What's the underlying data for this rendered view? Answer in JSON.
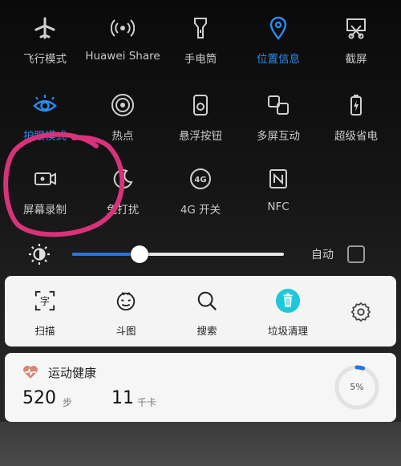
{
  "quick_settings": {
    "row1": [
      {
        "label": "飞行模式",
        "icon": "airplane-icon",
        "active": false
      },
      {
        "label": "Huawei Share",
        "icon": "huawei-share-icon",
        "active": false
      },
      {
        "label": "手电筒",
        "icon": "flashlight-icon",
        "active": false
      },
      {
        "label": "位置信息",
        "icon": "location-icon",
        "active": true
      },
      {
        "label": "截屏",
        "icon": "screenshot-icon",
        "active": false
      }
    ],
    "row2": [
      {
        "label": "护眼模式",
        "icon": "eye-icon",
        "active": true
      },
      {
        "label": "热点",
        "icon": "hotspot-icon",
        "active": false
      },
      {
        "label": "悬浮按钮",
        "icon": "floating-button-icon",
        "active": false
      },
      {
        "label": "多屏互动",
        "icon": "multiscreen-icon",
        "active": false
      },
      {
        "label": "超级省电",
        "icon": "battery-saver-icon",
        "active": false
      }
    ],
    "row3": [
      {
        "label": "屏幕录制",
        "icon": "screen-record-icon",
        "active": false
      },
      {
        "label": "免打扰",
        "icon": "moon-icon",
        "active": false
      },
      {
        "label": "4G 开关",
        "icon": "4g-icon",
        "active": false
      },
      {
        "label": "NFC",
        "icon": "nfc-icon",
        "active": false
      }
    ]
  },
  "brightness": {
    "level": 0.32,
    "auto_label": "自动",
    "auto_checked": false
  },
  "quick_actions": [
    {
      "label": "扫描",
      "icon": "scan-icon"
    },
    {
      "label": "斗图",
      "icon": "emoji-face-icon"
    },
    {
      "label": "搜索",
      "icon": "search-icon"
    },
    {
      "label": "垃圾清理",
      "icon": "trash-icon"
    }
  ],
  "health": {
    "title": "运动健康",
    "steps": "520",
    "steps_unit": "步",
    "calories": "11",
    "calories_unit": "千卡",
    "goal_percent": "5%"
  },
  "colors": {
    "accent": "#2a8cf0",
    "trash_teal": "#1fc8d8",
    "annotation": "#d8327a",
    "heart": "#d58a78"
  }
}
